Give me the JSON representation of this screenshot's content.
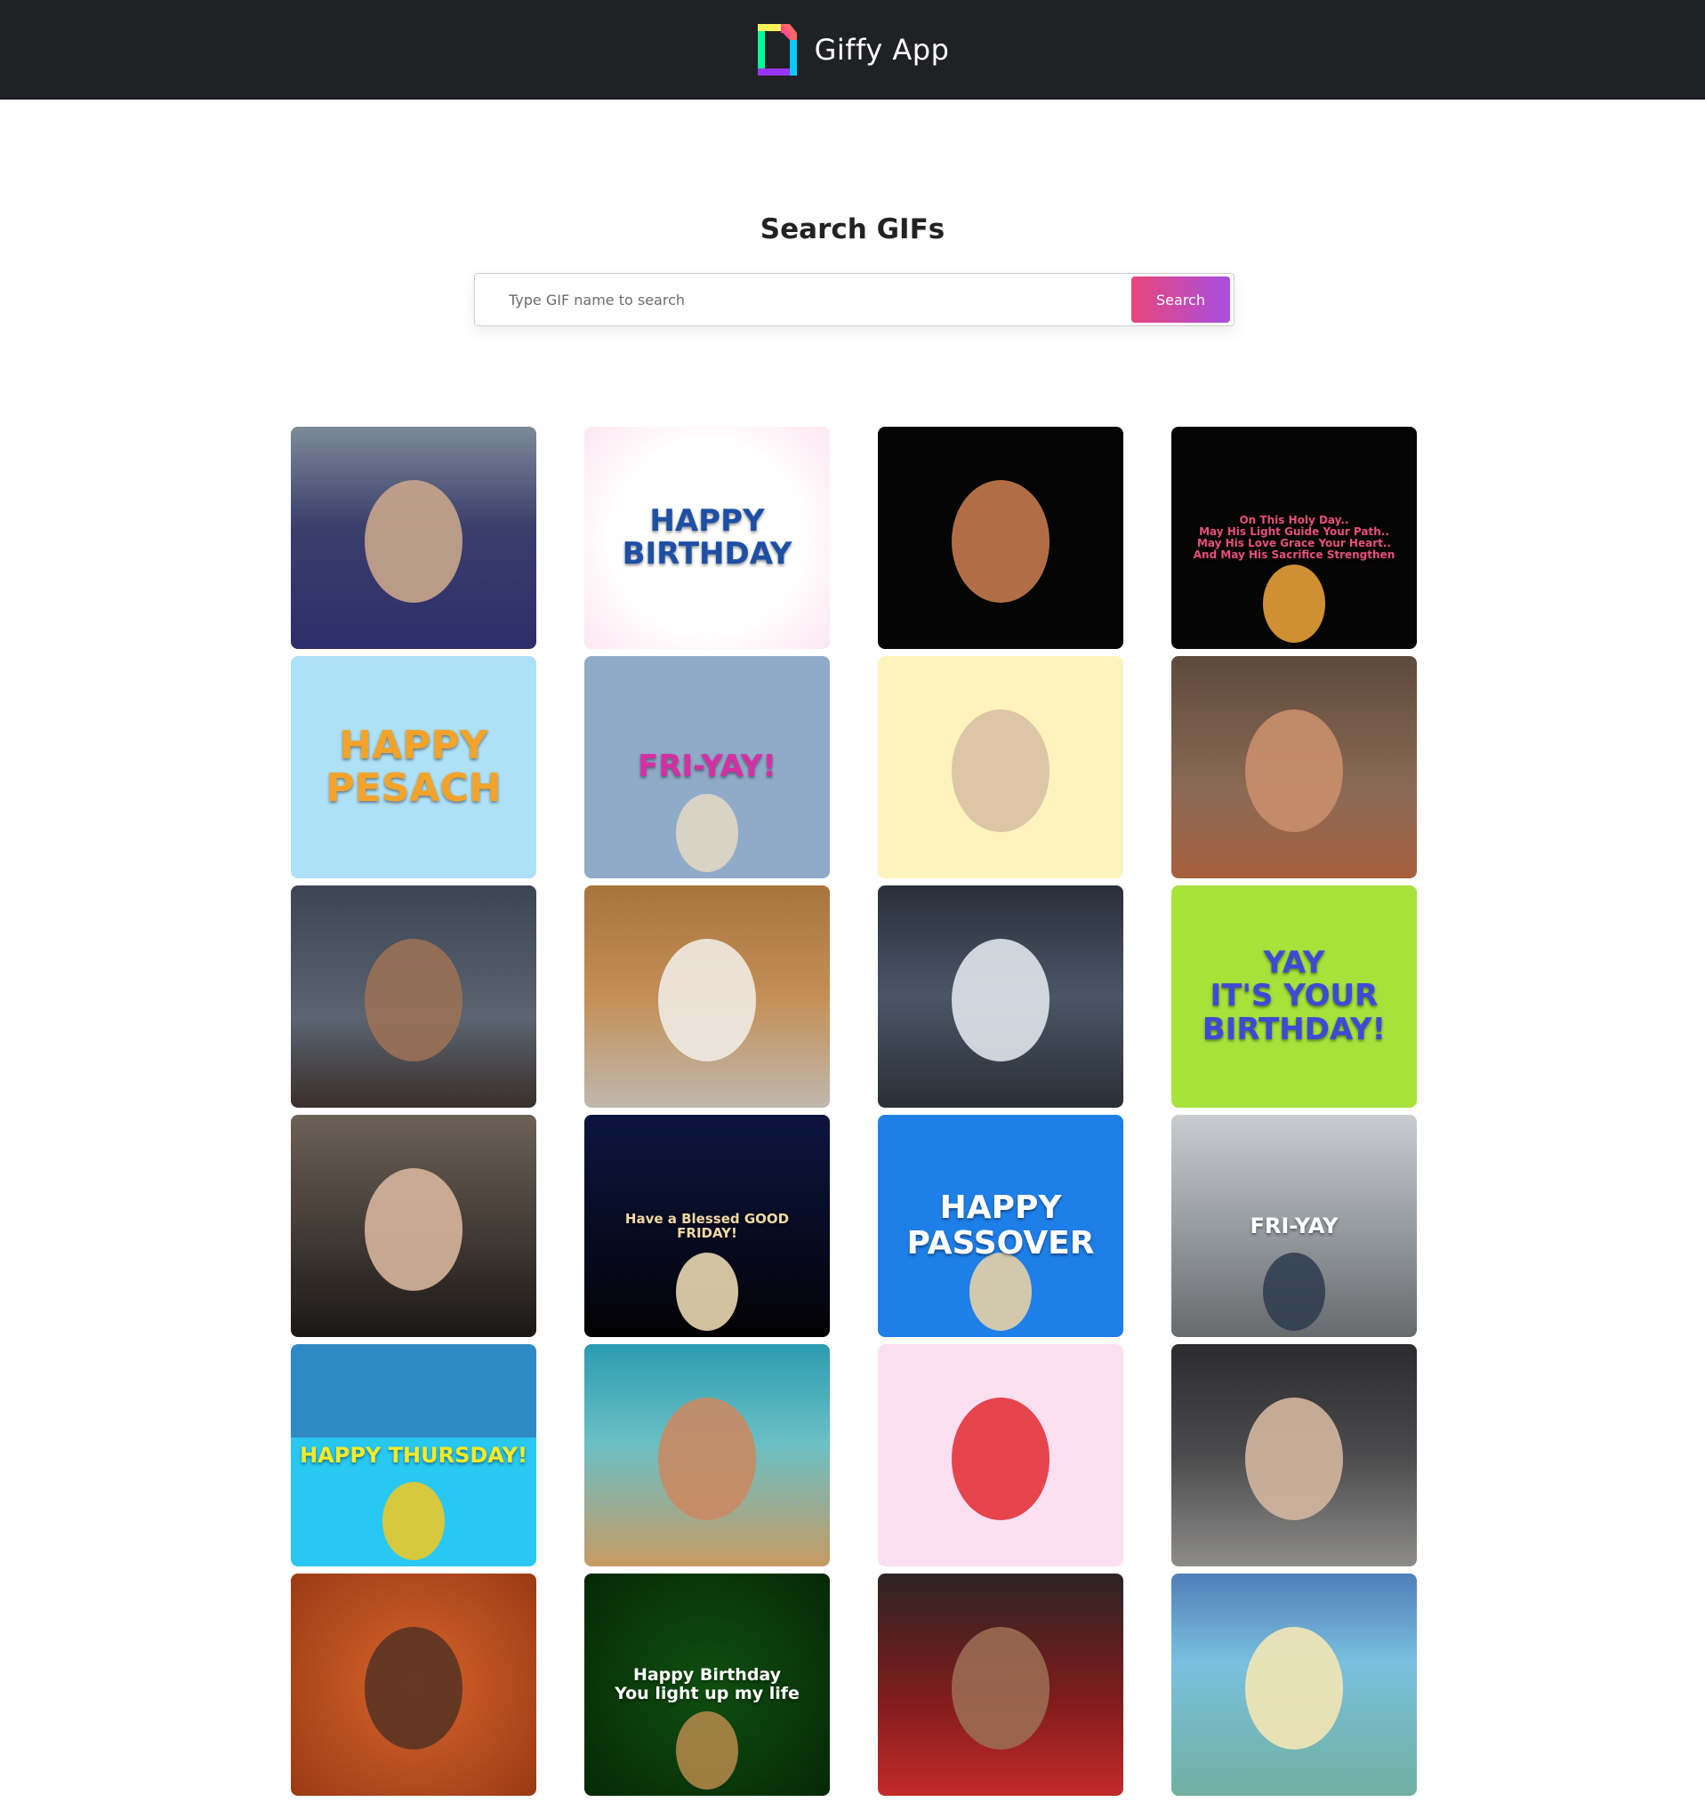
{
  "navbar": {
    "title": "Giffy App",
    "logo_icon": "giphy-logo-icon",
    "colors": {
      "background": "#202124",
      "text": "#ffffff"
    }
  },
  "search": {
    "title": "Search GIFs",
    "placeholder": "Type GIF name to search",
    "value": "",
    "button_label": "Search",
    "button_colors": [
      "#e8457a",
      "#a74fe0"
    ]
  },
  "gifs": [
    {
      "caption": "",
      "bg": "linear-gradient(180deg,#7d8a99 0%,#3a3f6b 45%,#2e2d6a 100%)",
      "fg": "#ffffff",
      "size": 20,
      "figure": "#c9a58c"
    },
    {
      "caption": "HAPPY\nBIRTHDAY",
      "bg": "radial-gradient(circle,#ffffff 55%,#fde7f1 100%)",
      "fg": "#1d4fa5",
      "size": 34,
      "figure": ""
    },
    {
      "caption": "",
      "bg": "#050505",
      "fg": "#ffffff",
      "size": 20,
      "figure": "#c47a4e"
    },
    {
      "caption": "On This Holy Day..\nMay His Light Guide Your Path..\nMay His Love Grace Your Heart..\nAnd May His Sacrifice Strengthen",
      "bg": "#050505",
      "fg": "#e9507a",
      "size": 12,
      "figure": "#f2a93b"
    },
    {
      "caption": "HAPPY\nPESACH",
      "bg": "#aee0f6",
      "fg": "#f3a32a",
      "size": 44,
      "figure": ""
    },
    {
      "caption": "FRI-YAY!",
      "bg": "#8fabc8",
      "fg": "#d42fa3",
      "size": 34,
      "figure": "#e5d9c4"
    },
    {
      "caption": "",
      "bg": "#fdf3bd",
      "fg": "#222222",
      "size": 20,
      "figure": "#d8c1a3"
    },
    {
      "caption": "",
      "bg": "linear-gradient(180deg,#5e4a3c 0%,#8a6a55 60%,#a7603f 100%)",
      "fg": "#ffffff",
      "size": 20,
      "figure": "#c98f6d"
    },
    {
      "caption": "",
      "bg": "linear-gradient(180deg,#3c4652 0%,#5b6470 60%,#3a2f2a 100%)",
      "fg": "#ffffff",
      "size": 20,
      "figure": "#9b7157"
    },
    {
      "caption": "",
      "bg": "linear-gradient(180deg,#a7743f 0%,#c48f56 50%,#bfb8ae 100%)",
      "fg": "#ffffff",
      "size": 20,
      "figure": "#efebe3"
    },
    {
      "caption": "",
      "bg": "linear-gradient(180deg,#2a2f3a 0%,#4a5666 50%,#2b2f36 100%)",
      "fg": "#ffffff",
      "size": 20,
      "figure": "#dfe4ea"
    },
    {
      "caption": "YAY\nIT'S YOUR\nBIRTHDAY!",
      "bg": "#a7e23b",
      "fg": "#3c4bd6",
      "size": 34,
      "figure": ""
    },
    {
      "caption": "",
      "bg": "linear-gradient(180deg,#6b6156 0%,#3d3631 60%,#1b1816 100%)",
      "fg": "#ffffff",
      "size": 20,
      "figure": "#d7b59b"
    },
    {
      "caption": "Have a Blessed GOOD FRIDAY!",
      "bg": "linear-gradient(180deg,#0c1540 0%,#060818 70%,#020202 100%)",
      "fg": "#f1d9a3",
      "size": 15,
      "figure": "#f7e3b8"
    },
    {
      "caption": "HAPPY\nPASSOVER",
      "bg": "#1f7fe8",
      "fg": "#ffffff",
      "size": 36,
      "figure": "#f1d5a2"
    },
    {
      "caption": "FRI-YAY",
      "bg": "linear-gradient(180deg,#c9ccd0 0%,#8e9398 60%,#686a6c 100%)",
      "fg": "#ffffff",
      "size": 24,
      "figure": "#2d3b4d"
    },
    {
      "caption": "HAPPY THURSDAY!",
      "bg": "linear-gradient(180deg,#2f89c3 0%,#2f89c3 42%,#28c8f2 42%,#28c8f2 100%)",
      "fg": "#f7ea25",
      "size": 24,
      "figure": "#f5c91f"
    },
    {
      "caption": "",
      "bg": "linear-gradient(180deg,#2b9bb0 0%,#6cc0c5 45%,#c79a63 100%)",
      "fg": "#ffffff",
      "size": 20,
      "figure": "#c98a63"
    },
    {
      "caption": "",
      "bg": "#fcdff0",
      "fg": "#222222",
      "size": 20,
      "figure": "#e3343c"
    },
    {
      "caption": "",
      "bg": "linear-gradient(180deg,#2c2c2e 0%,#4b4b4d 50%,#8d8c8a 100%)",
      "fg": "#ffffff",
      "size": 20,
      "figure": "#d4b7a0"
    },
    {
      "caption": "",
      "bg": "radial-gradient(circle,#d7652c 0%,#9a3a14 100%)",
      "fg": "#ffffff",
      "size": 20,
      "figure": "#5a3424"
    },
    {
      "caption": "Happy Birthday\nYou light up my life",
      "bg": "radial-gradient(circle,#0f4f10 0%,#062806 100%)",
      "fg": "#ffffff",
      "size": 19,
      "figure": "#b88a4d"
    },
    {
      "caption": "",
      "bg": "linear-gradient(180deg,#2d2424 0%,#7d1c1c 55%,#c42a2a 100%)",
      "fg": "#ffffff",
      "size": 20,
      "figure": "#9b6b52"
    },
    {
      "caption": "",
      "bg": "linear-gradient(180deg,#4f7fb8 0%,#7ac0de 40%,#6fb0a0 100%)",
      "fg": "#ffffff",
      "size": 20,
      "figure": "#f3e7b5"
    }
  ]
}
